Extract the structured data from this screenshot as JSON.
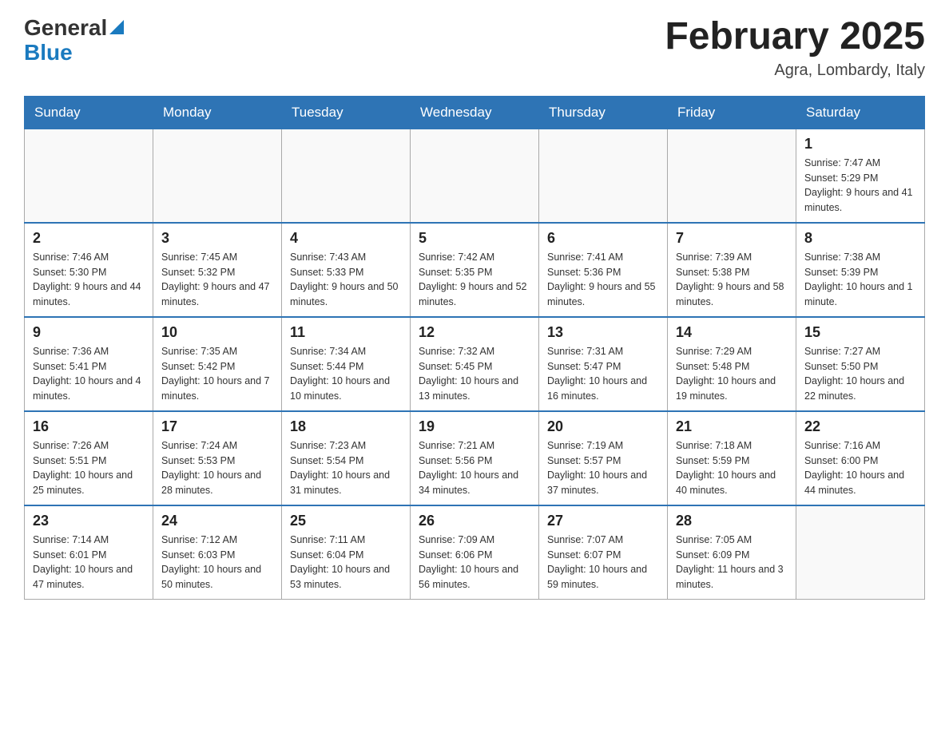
{
  "header": {
    "title": "February 2025",
    "location": "Agra, Lombardy, Italy",
    "logo_general": "General",
    "logo_blue": "Blue"
  },
  "days_of_week": [
    "Sunday",
    "Monday",
    "Tuesday",
    "Wednesday",
    "Thursday",
    "Friday",
    "Saturday"
  ],
  "weeks": [
    {
      "days": [
        {
          "date": "",
          "info": ""
        },
        {
          "date": "",
          "info": ""
        },
        {
          "date": "",
          "info": ""
        },
        {
          "date": "",
          "info": ""
        },
        {
          "date": "",
          "info": ""
        },
        {
          "date": "",
          "info": ""
        },
        {
          "date": "1",
          "info": "Sunrise: 7:47 AM\nSunset: 5:29 PM\nDaylight: 9 hours and 41 minutes."
        }
      ]
    },
    {
      "days": [
        {
          "date": "2",
          "info": "Sunrise: 7:46 AM\nSunset: 5:30 PM\nDaylight: 9 hours and 44 minutes."
        },
        {
          "date": "3",
          "info": "Sunrise: 7:45 AM\nSunset: 5:32 PM\nDaylight: 9 hours and 47 minutes."
        },
        {
          "date": "4",
          "info": "Sunrise: 7:43 AM\nSunset: 5:33 PM\nDaylight: 9 hours and 50 minutes."
        },
        {
          "date": "5",
          "info": "Sunrise: 7:42 AM\nSunset: 5:35 PM\nDaylight: 9 hours and 52 minutes."
        },
        {
          "date": "6",
          "info": "Sunrise: 7:41 AM\nSunset: 5:36 PM\nDaylight: 9 hours and 55 minutes."
        },
        {
          "date": "7",
          "info": "Sunrise: 7:39 AM\nSunset: 5:38 PM\nDaylight: 9 hours and 58 minutes."
        },
        {
          "date": "8",
          "info": "Sunrise: 7:38 AM\nSunset: 5:39 PM\nDaylight: 10 hours and 1 minute."
        }
      ]
    },
    {
      "days": [
        {
          "date": "9",
          "info": "Sunrise: 7:36 AM\nSunset: 5:41 PM\nDaylight: 10 hours and 4 minutes."
        },
        {
          "date": "10",
          "info": "Sunrise: 7:35 AM\nSunset: 5:42 PM\nDaylight: 10 hours and 7 minutes."
        },
        {
          "date": "11",
          "info": "Sunrise: 7:34 AM\nSunset: 5:44 PM\nDaylight: 10 hours and 10 minutes."
        },
        {
          "date": "12",
          "info": "Sunrise: 7:32 AM\nSunset: 5:45 PM\nDaylight: 10 hours and 13 minutes."
        },
        {
          "date": "13",
          "info": "Sunrise: 7:31 AM\nSunset: 5:47 PM\nDaylight: 10 hours and 16 minutes."
        },
        {
          "date": "14",
          "info": "Sunrise: 7:29 AM\nSunset: 5:48 PM\nDaylight: 10 hours and 19 minutes."
        },
        {
          "date": "15",
          "info": "Sunrise: 7:27 AM\nSunset: 5:50 PM\nDaylight: 10 hours and 22 minutes."
        }
      ]
    },
    {
      "days": [
        {
          "date": "16",
          "info": "Sunrise: 7:26 AM\nSunset: 5:51 PM\nDaylight: 10 hours and 25 minutes."
        },
        {
          "date": "17",
          "info": "Sunrise: 7:24 AM\nSunset: 5:53 PM\nDaylight: 10 hours and 28 minutes."
        },
        {
          "date": "18",
          "info": "Sunrise: 7:23 AM\nSunset: 5:54 PM\nDaylight: 10 hours and 31 minutes."
        },
        {
          "date": "19",
          "info": "Sunrise: 7:21 AM\nSunset: 5:56 PM\nDaylight: 10 hours and 34 minutes."
        },
        {
          "date": "20",
          "info": "Sunrise: 7:19 AM\nSunset: 5:57 PM\nDaylight: 10 hours and 37 minutes."
        },
        {
          "date": "21",
          "info": "Sunrise: 7:18 AM\nSunset: 5:59 PM\nDaylight: 10 hours and 40 minutes."
        },
        {
          "date": "22",
          "info": "Sunrise: 7:16 AM\nSunset: 6:00 PM\nDaylight: 10 hours and 44 minutes."
        }
      ]
    },
    {
      "days": [
        {
          "date": "23",
          "info": "Sunrise: 7:14 AM\nSunset: 6:01 PM\nDaylight: 10 hours and 47 minutes."
        },
        {
          "date": "24",
          "info": "Sunrise: 7:12 AM\nSunset: 6:03 PM\nDaylight: 10 hours and 50 minutes."
        },
        {
          "date": "25",
          "info": "Sunrise: 7:11 AM\nSunset: 6:04 PM\nDaylight: 10 hours and 53 minutes."
        },
        {
          "date": "26",
          "info": "Sunrise: 7:09 AM\nSunset: 6:06 PM\nDaylight: 10 hours and 56 minutes."
        },
        {
          "date": "27",
          "info": "Sunrise: 7:07 AM\nSunset: 6:07 PM\nDaylight: 10 hours and 59 minutes."
        },
        {
          "date": "28",
          "info": "Sunrise: 7:05 AM\nSunset: 6:09 PM\nDaylight: 11 hours and 3 minutes."
        },
        {
          "date": "",
          "info": ""
        }
      ]
    }
  ]
}
